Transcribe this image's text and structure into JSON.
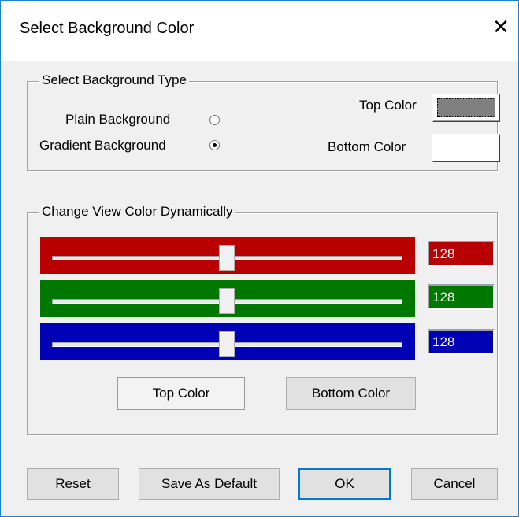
{
  "window": {
    "title": "Select Background Color",
    "close_glyph": "✕"
  },
  "background_type": {
    "legend": "Select Background Type",
    "plain_label": "Plain Background",
    "gradient_label": "Gradient Background",
    "selected": "gradient",
    "top_color_label": "Top Color",
    "bottom_color_label": "Bottom Color",
    "top_color_value": "#808080",
    "bottom_color_value": "#ffffff"
  },
  "dynamic": {
    "legend": "Change View  Color Dynamically",
    "sliders": [
      {
        "channel": "red",
        "value": "128",
        "band_color": "#b80000",
        "box_color": "#b80000",
        "level": 0.5
      },
      {
        "channel": "green",
        "value": "128",
        "band_color": "#007800",
        "box_color": "#007800",
        "level": 0.5
      },
      {
        "channel": "blue",
        "value": "128",
        "band_color": "#0000b4",
        "box_color": "#0000b4",
        "level": 0.5
      }
    ],
    "top_color_button": "Top Color",
    "bottom_color_button": "Bottom Color"
  },
  "footer": {
    "reset": "Reset",
    "save_default": "Save As Default",
    "ok": "OK",
    "cancel": "Cancel"
  }
}
